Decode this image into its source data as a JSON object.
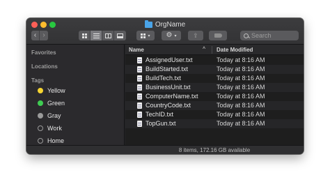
{
  "window": {
    "title": "OrgName"
  },
  "toolbar": {
    "back_icon": "chevron-left",
    "forward_icon": "chevron-right",
    "view_modes": [
      "icons",
      "list",
      "columns",
      "gallery"
    ],
    "active_view": "list",
    "group_icon": "grid",
    "action_icon": "gear",
    "share_icon": "share",
    "tag_icon": "tag",
    "search_placeholder": "Search"
  },
  "sidebar": {
    "favorites_label": "Favorites",
    "locations_label": "Locations",
    "tags_label": "Tags",
    "tags": [
      {
        "label": "Yellow",
        "color": "#f5d431"
      },
      {
        "label": "Green",
        "color": "#3fcc52"
      },
      {
        "label": "Gray",
        "color": "#9a9a9a"
      },
      {
        "label": "Work",
        "color": ""
      },
      {
        "label": "Home",
        "color": ""
      }
    ]
  },
  "columns": {
    "name": "Name",
    "date": "Date Modified",
    "sort_indicator": "^"
  },
  "files": [
    {
      "name": "AssignedUser.txt",
      "date": "Today at 8:16 AM"
    },
    {
      "name": "BuildStarted.txt",
      "date": "Today at 8:16 AM"
    },
    {
      "name": "BuildTech.txt",
      "date": "Today at 8:16 AM"
    },
    {
      "name": "BusinessUnit.txt",
      "date": "Today at 8:16 AM"
    },
    {
      "name": "ComputerName.txt",
      "date": "Today at 8:16 AM"
    },
    {
      "name": "CountryCode.txt",
      "date": "Today at 8:16 AM"
    },
    {
      "name": "TechID.txt",
      "date": "Today at 8:16 AM"
    },
    {
      "name": "TopGun.txt",
      "date": "Today at 8:16 AM"
    }
  ],
  "status": {
    "text": "8 items, 172.16 GB available"
  }
}
